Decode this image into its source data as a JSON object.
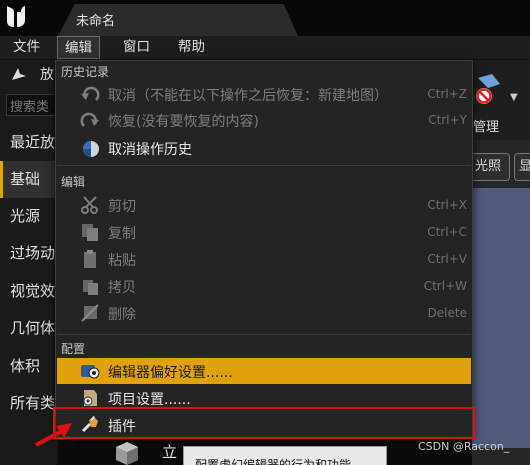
{
  "window": {
    "tab_title": "未命名"
  },
  "menubar": {
    "items": [
      "文件",
      "编辑",
      "窗口",
      "帮助"
    ],
    "active": "编辑"
  },
  "left_panel": {
    "header": "放",
    "search_placeholder": "搜索类",
    "categories": [
      "最近放",
      "基础",
      "光源",
      "过场动",
      "视觉效",
      "几何体",
      "体积",
      "所有类"
    ],
    "selected": "基础"
  },
  "right_panel": {
    "manage_label": "管理",
    "light_button": "光照",
    "display_button": "显"
  },
  "dropdown": {
    "sections": [
      {
        "header": "历史记录",
        "items": [
          {
            "label": "取消（不能在以下操作之后恢复：新建地图）",
            "shortcut": "Ctrl+Z",
            "icon": "undo-icon",
            "enabled": false
          },
          {
            "label": "恢复(没有要恢复的内容)",
            "shortcut": "Ctrl+Y",
            "icon": "redo-icon",
            "enabled": false
          },
          {
            "label": "取消操作历史",
            "shortcut": "",
            "icon": "history-icon",
            "enabled": true
          }
        ]
      },
      {
        "header": "编辑",
        "items": [
          {
            "label": "剪切",
            "shortcut": "Ctrl+X",
            "icon": "scissors-icon",
            "enabled": false
          },
          {
            "label": "复制",
            "shortcut": "Ctrl+C",
            "icon": "copy-icon",
            "enabled": false
          },
          {
            "label": "粘贴",
            "shortcut": "Ctrl+V",
            "icon": "paste-icon",
            "enabled": false
          },
          {
            "label": "拷贝",
            "shortcut": "Ctrl+W",
            "icon": "duplicate-icon",
            "enabled": false
          },
          {
            "label": "删除",
            "shortcut": "Delete",
            "icon": "delete-icon",
            "enabled": false
          }
        ]
      },
      {
        "header": "配置",
        "items": [
          {
            "label": "编辑器偏好设置......",
            "shortcut": "",
            "icon": "editor-preferences-icon",
            "enabled": true,
            "highlighted": true
          },
          {
            "label": "项目设置......",
            "shortcut": "",
            "icon": "project-settings-icon",
            "enabled": true
          },
          {
            "label": "插件",
            "shortcut": "",
            "icon": "plugin-icon",
            "enabled": true
          }
        ]
      }
    ]
  },
  "below_menu": {
    "cube_label": "立",
    "tooltip": "配置虚幻编辑器的行为和功能"
  },
  "watermark": "CSDN @Raccon_",
  "colors": {
    "highlight": "#e0a10b",
    "annotation": "#e01010",
    "background": "#242424"
  }
}
